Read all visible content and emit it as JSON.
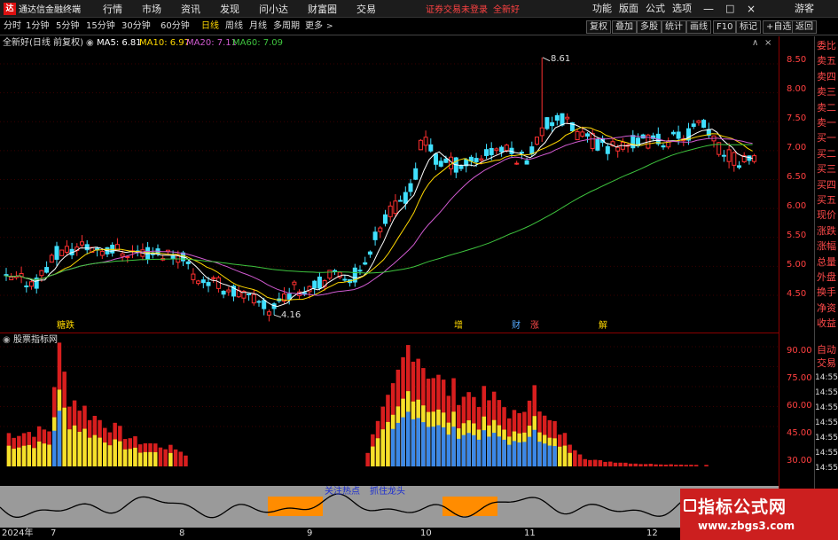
{
  "app": {
    "name": "通达信金融终端",
    "menus": [
      "行情",
      "市场",
      "资讯",
      "发现",
      "问小达",
      "财富圈",
      "交易"
    ],
    "notice": "证券交易未登录",
    "stock_name_top": "全新好",
    "right_menus": [
      "功能",
      "版面",
      "公式",
      "选项"
    ],
    "guest": "游客"
  },
  "periods": [
    "分时",
    "1分钟",
    "5分钟",
    "15分钟",
    "30分钟",
    "60分钟",
    "日线",
    "周线",
    "月线",
    "多周期",
    "更多"
  ],
  "active_period": "日线",
  "toolbar_right": [
    "复权",
    "叠加",
    "多股",
    "统计",
    "画线",
    "F10",
    "标记",
    "+自选",
    "返回"
  ],
  "chart": {
    "title": "全新好(日线 前复权)",
    "ma": [
      {
        "label": "MA5: 6.81",
        "color": "#ffffff"
      },
      {
        "label": "MA10: 6.97",
        "color": "#ffd800"
      },
      {
        "label": "MA20: 7.11",
        "color": "#d05ad0"
      },
      {
        "label": "MA60: 7.09",
        "color": "#3ec43e"
      }
    ],
    "high_label": "8.61",
    "low_label": "4.16",
    "events": [
      {
        "text": "糖跌",
        "color": "#ffd800"
      },
      {
        "text": "增",
        "color": "#ffd800"
      },
      {
        "text": "财",
        "color": "#5af"
      },
      {
        "text": "涨",
        "color": "#ff4a4a"
      },
      {
        "text": "解",
        "color": "#ffd800"
      }
    ],
    "axis": [
      "8.50",
      "8.00",
      "7.50",
      "7.00",
      "6.50",
      "6.00",
      "5.50",
      "5.00",
      "4.50"
    ]
  },
  "indicator": {
    "title": "股票指标网",
    "axis": [
      "90.00",
      "75.00",
      "60.00",
      "45.00",
      "30.00"
    ],
    "osc_labels": [
      "关注热点",
      "抓住龙头"
    ]
  },
  "dates": [
    "2024年",
    "7",
    "8",
    "9",
    "10",
    "11",
    "12"
  ],
  "side": {
    "items": [
      {
        "t": "委比",
        "c": "red"
      },
      {
        "t": "卖五",
        "c": "red"
      },
      {
        "t": "卖四",
        "c": "red"
      },
      {
        "t": "卖三",
        "c": "red"
      },
      {
        "t": "卖二",
        "c": "red"
      },
      {
        "t": "卖一",
        "c": "red"
      },
      {
        "t": "买一",
        "c": "red"
      },
      {
        "t": "买二",
        "c": "red"
      },
      {
        "t": "买三",
        "c": "red"
      },
      {
        "t": "买四",
        "c": "red"
      },
      {
        "t": "买五",
        "c": "red"
      },
      {
        "t": "现价",
        "c": "red"
      },
      {
        "t": "涨跌",
        "c": "red"
      },
      {
        "t": "涨幅",
        "c": "red"
      },
      {
        "t": "总量",
        "c": "red"
      },
      {
        "t": "外盘",
        "c": "red"
      },
      {
        "t": "换手",
        "c": "red"
      },
      {
        "t": "净资",
        "c": "red"
      },
      {
        "t": "收益",
        "c": "red"
      }
    ],
    "auto": "自动",
    "trade": "交易",
    "times": [
      "14:55",
      "14:55",
      "14:55",
      "14:55",
      "14:55",
      "14:55",
      "14:55"
    ]
  },
  "watermark": {
    "title": "指标公式网",
    "url": "www.zbgs3.com"
  }
}
